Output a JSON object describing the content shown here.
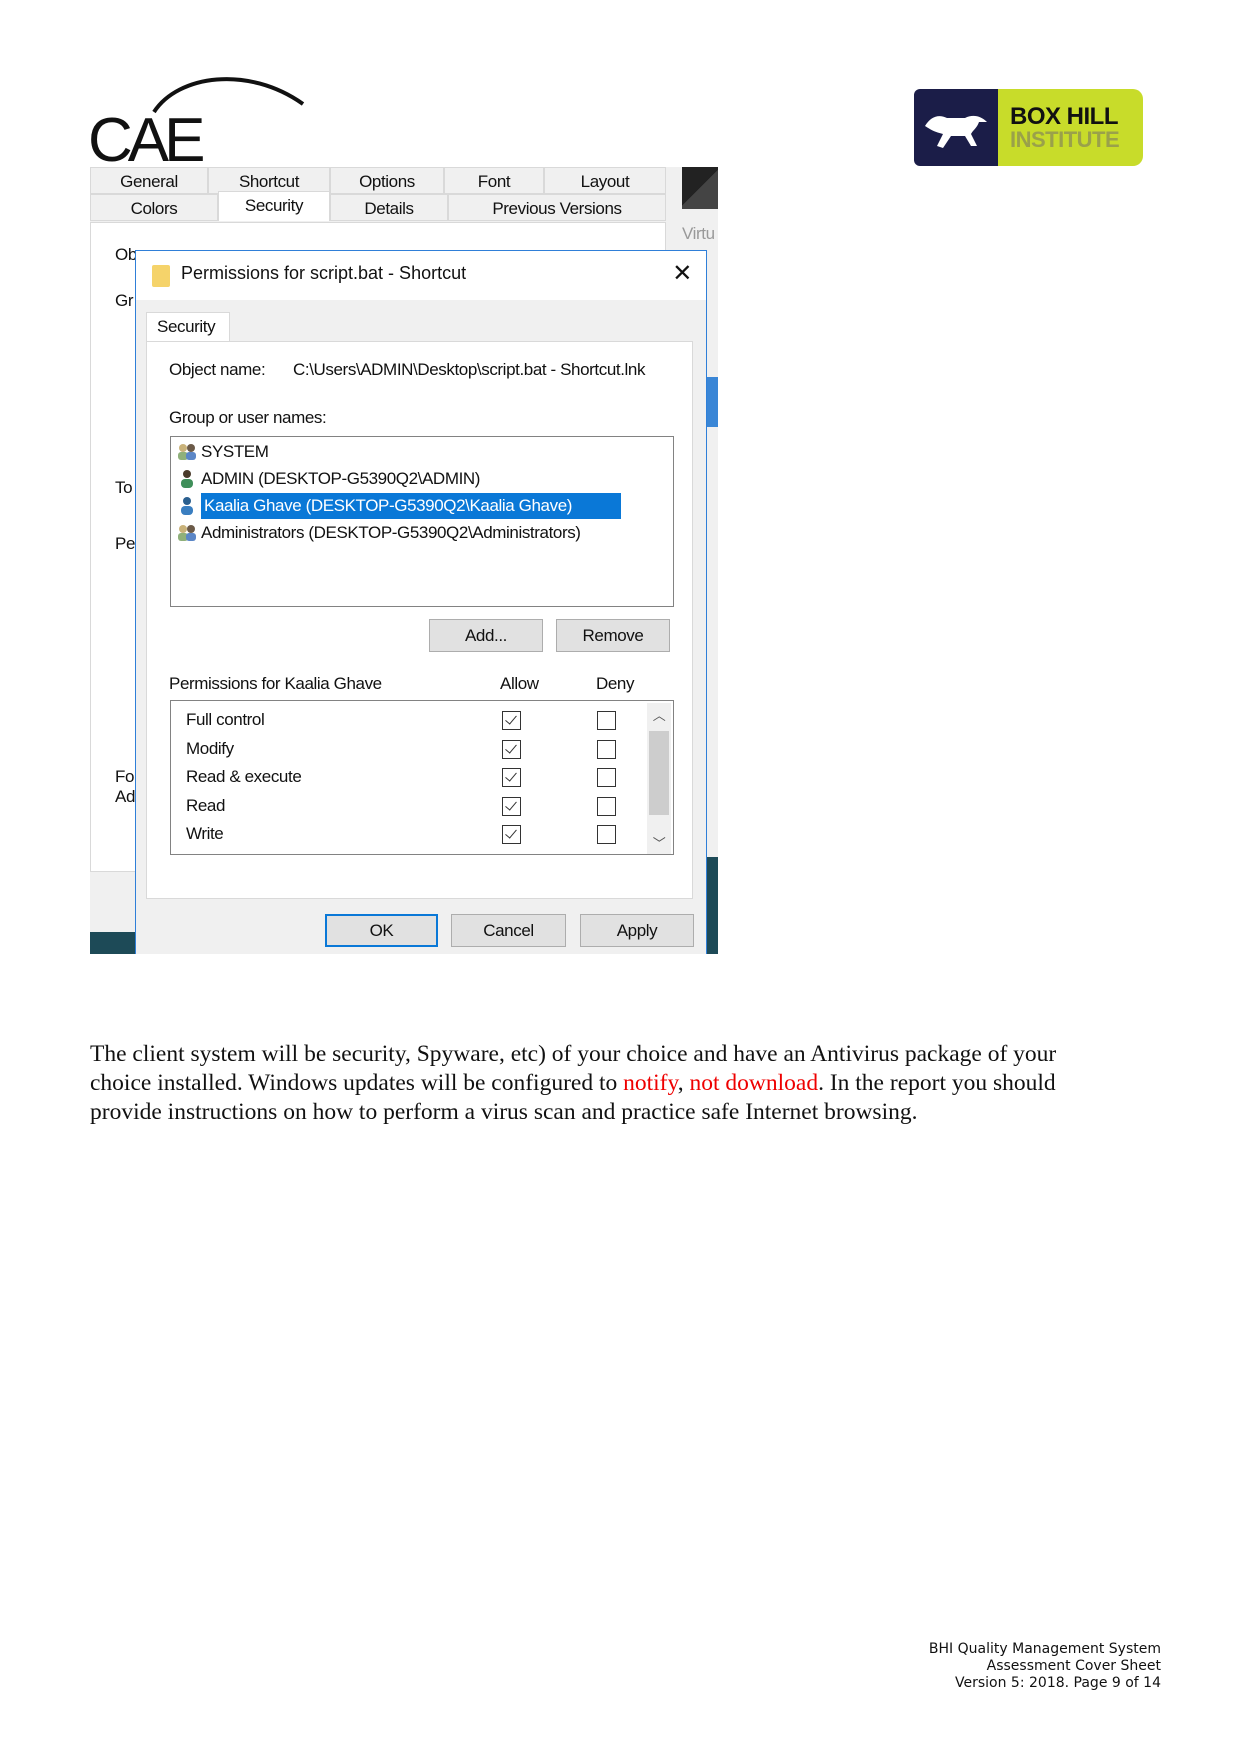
{
  "logos": {
    "cae": {
      "text": "CAE"
    },
    "box_hill": {
      "line1": "BOX HILL",
      "line2": "INSTITUTE",
      "brand_green": "#c8dc2a",
      "brand_navy": "#1b1d48"
    }
  },
  "screenshot": {
    "background_window": {
      "tabs_row1": [
        "General",
        "Shortcut",
        "Options",
        "Font",
        "Layout"
      ],
      "tabs_row2": [
        "Colors",
        "Security",
        "Details",
        "Previous Versions"
      ],
      "selected_tab": "Security",
      "obscured_fragments": [
        "Ob",
        "Gr",
        "To",
        "Pe",
        "Fo",
        "Ad"
      ],
      "right_edge_fragment": "Virtu"
    },
    "dialog": {
      "title": "Permissions for script.bat - Shortcut",
      "close_icon": "close-icon",
      "tab": "Security",
      "object_name_label": "Object name:",
      "object_name_value": "C:\\Users\\ADMIN\\Desktop\\script.bat - Shortcut.lnk",
      "group_label": "Group or user names:",
      "users": [
        {
          "name": "SYSTEM",
          "icon": "group-icon"
        },
        {
          "name": "ADMIN (DESKTOP-G5390Q2\\ADMIN)",
          "icon": "user-icon"
        },
        {
          "name": "Kaalia Ghave (DESKTOP-G5390Q2\\Kaalia Ghave)",
          "icon": "user-icon",
          "selected": true
        },
        {
          "name": "Administrators (DESKTOP-G5390Q2\\Administrators)",
          "icon": "group-icon"
        }
      ],
      "add_label": "Add...",
      "remove_label": "Remove",
      "permissions_label": "Permissions for Kaalia Ghave",
      "allow_label": "Allow",
      "deny_label": "Deny",
      "permissions": [
        {
          "name": "Full control",
          "allow": true,
          "deny": false
        },
        {
          "name": "Modify",
          "allow": true,
          "deny": false
        },
        {
          "name": "Read & execute",
          "allow": true,
          "deny": false
        },
        {
          "name": "Read",
          "allow": true,
          "deny": false
        },
        {
          "name": "Write",
          "allow": true,
          "deny": false
        }
      ],
      "ok_label": "OK",
      "cancel_label": "Cancel",
      "apply_label": "Apply",
      "selection_color": "#0a78d7"
    }
  },
  "paragraph": {
    "s1": "The client system will be security, Spyware, etc) of your choice and have an Antivirus package of your",
    "s2": "choice installed.  Windows updates will be configured to ",
    "red1": "notify",
    "s3": ", ",
    "red2": "not download",
    "s4": ".  In the report you should",
    "s5": "provide instructions on how to perform a virus scan and practice safe Internet browsing.",
    "highlight_color": "#e00000"
  },
  "footer": {
    "line1": "BHI Quality Management System",
    "line2": "Assessment Cover Sheet",
    "line3": "Version 5: 2018. Page 9 of 14"
  }
}
